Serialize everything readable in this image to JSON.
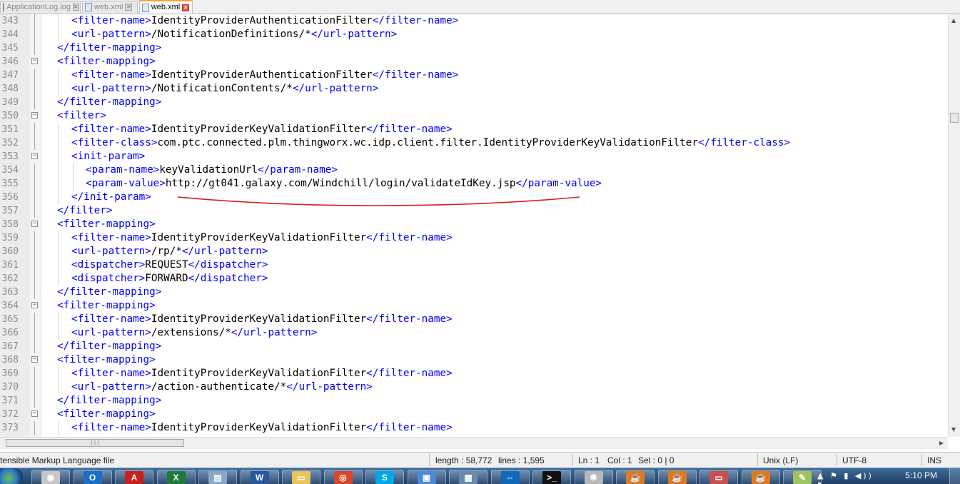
{
  "tabs": [
    {
      "label": "ApplicationLog.log",
      "active": false
    },
    {
      "label": "web.xml",
      "active": false
    },
    {
      "label": "web.xml",
      "active": true
    }
  ],
  "lines": [
    {
      "num": "343",
      "indent": 2,
      "segs": [
        {
          "s": "<filter-name>"
        },
        {
          "t": "IdentityProviderAuthenticationFilter"
        },
        {
          "s": "</filter-name>"
        }
      ]
    },
    {
      "num": "344",
      "indent": 2,
      "segs": [
        {
          "s": "<url-pattern>"
        },
        {
          "t": "/NotificationDefinitions/*"
        },
        {
          "s": "</url-pattern>"
        }
      ]
    },
    {
      "num": "345",
      "indent": 1,
      "segs": [
        {
          "s": "</filter-mapping>"
        }
      ]
    },
    {
      "num": "346",
      "indent": 1,
      "fold": true,
      "segs": [
        {
          "s": "<filter-mapping>"
        }
      ]
    },
    {
      "num": "347",
      "indent": 2,
      "segs": [
        {
          "s": "<filter-name>"
        },
        {
          "t": "IdentityProviderAuthenticationFilter"
        },
        {
          "s": "</filter-name>"
        }
      ]
    },
    {
      "num": "348",
      "indent": 2,
      "segs": [
        {
          "s": "<url-pattern>"
        },
        {
          "t": "/NotificationContents/*"
        },
        {
          "s": "</url-pattern>"
        }
      ]
    },
    {
      "num": "349",
      "indent": 1,
      "segs": [
        {
          "s": "</filter-mapping>"
        }
      ]
    },
    {
      "num": "350",
      "indent": 1,
      "fold": true,
      "segs": [
        {
          "s": "<filter>"
        }
      ]
    },
    {
      "num": "351",
      "indent": 2,
      "segs": [
        {
          "s": "<filter-name>"
        },
        {
          "t": "IdentityProviderKeyValidationFilter"
        },
        {
          "s": "</filter-name>"
        }
      ]
    },
    {
      "num": "352",
      "indent": 2,
      "segs": [
        {
          "s": "<filter-class>"
        },
        {
          "t": "com.ptc.connected.plm.thingworx.wc.idp.client.filter.IdentityProviderKeyValidationFilter"
        },
        {
          "s": "</filter-class>"
        }
      ]
    },
    {
      "num": "353",
      "indent": 2,
      "fold": true,
      "segs": [
        {
          "s": "<init-param>"
        }
      ]
    },
    {
      "num": "354",
      "indent": 3,
      "segs": [
        {
          "s": "<param-name>"
        },
        {
          "t": "keyValidationUrl"
        },
        {
          "s": "</param-name>"
        }
      ]
    },
    {
      "num": "355",
      "indent": 3,
      "segs": [
        {
          "s": "<param-value>"
        },
        {
          "t": "http://gt041.galaxy.com/Windchill/login/validateIdKey.jsp"
        },
        {
          "s": "</param-value>"
        }
      ]
    },
    {
      "num": "356",
      "indent": 2,
      "segs": [
        {
          "s": "</init-param>"
        }
      ]
    },
    {
      "num": "357",
      "indent": 1,
      "segs": [
        {
          "s": "</filter>"
        }
      ]
    },
    {
      "num": "358",
      "indent": 1,
      "fold": true,
      "segs": [
        {
          "s": "<filter-mapping>"
        }
      ]
    },
    {
      "num": "359",
      "indent": 2,
      "segs": [
        {
          "s": "<filter-name>"
        },
        {
          "t": "IdentityProviderKeyValidationFilter"
        },
        {
          "s": "</filter-name>"
        }
      ]
    },
    {
      "num": "360",
      "indent": 2,
      "segs": [
        {
          "s": "<url-pattern>"
        },
        {
          "t": "/rp/*"
        },
        {
          "s": "</url-pattern>"
        }
      ]
    },
    {
      "num": "361",
      "indent": 2,
      "segs": [
        {
          "s": "<dispatcher>"
        },
        {
          "t": "REQUEST"
        },
        {
          "s": "</dispatcher>"
        }
      ]
    },
    {
      "num": "362",
      "indent": 2,
      "segs": [
        {
          "s": "<dispatcher>"
        },
        {
          "t": "FORWARD"
        },
        {
          "s": "</dispatcher>"
        }
      ]
    },
    {
      "num": "363",
      "indent": 1,
      "segs": [
        {
          "s": "</filter-mapping>"
        }
      ]
    },
    {
      "num": "364",
      "indent": 1,
      "fold": true,
      "segs": [
        {
          "s": "<filter-mapping>"
        }
      ]
    },
    {
      "num": "365",
      "indent": 2,
      "segs": [
        {
          "s": "<filter-name>"
        },
        {
          "t": "IdentityProviderKeyValidationFilter"
        },
        {
          "s": "</filter-name>"
        }
      ]
    },
    {
      "num": "366",
      "indent": 2,
      "segs": [
        {
          "s": "<url-pattern>"
        },
        {
          "t": "/extensions/*"
        },
        {
          "s": "</url-pattern>"
        }
      ]
    },
    {
      "num": "367",
      "indent": 1,
      "segs": [
        {
          "s": "</filter-mapping>"
        }
      ]
    },
    {
      "num": "368",
      "indent": 1,
      "fold": true,
      "segs": [
        {
          "s": "<filter-mapping>"
        }
      ]
    },
    {
      "num": "369",
      "indent": 2,
      "segs": [
        {
          "s": "<filter-name>"
        },
        {
          "t": "IdentityProviderKeyValidationFilter"
        },
        {
          "s": "</filter-name>"
        }
      ]
    },
    {
      "num": "370",
      "indent": 2,
      "segs": [
        {
          "s": "<url-pattern>"
        },
        {
          "t": "/action-authenticate/*"
        },
        {
          "s": "</url-pattern>"
        }
      ]
    },
    {
      "num": "371",
      "indent": 1,
      "segs": [
        {
          "s": "</filter-mapping>"
        }
      ]
    },
    {
      "num": "372",
      "indent": 1,
      "fold": true,
      "segs": [
        {
          "s": "<filter-mapping>"
        }
      ]
    },
    {
      "num": "373",
      "indent": 2,
      "segs": [
        {
          "s": "<filter-name>"
        },
        {
          "t": "IdentityProviderKeyValidationFilter"
        },
        {
          "s": "</filter-name>"
        }
      ]
    }
  ],
  "annotation_color": "#d42020",
  "colors": {
    "tag": "#0000ff",
    "text": "#000000",
    "line_number": "#8c8c8c"
  },
  "status": {
    "file_type": "tensible Markup Language file",
    "length": "length : 58,772",
    "lines": "lines : 1,595",
    "ln": "Ln : 1",
    "col": "Col : 1",
    "sel": "Sel : 0 | 0",
    "eol": "Unix (LF)",
    "encoding": "UTF-8",
    "mode": "INS"
  },
  "taskbar": {
    "apps": [
      {
        "name": "media-player-icon",
        "glyph": "◉",
        "color": "#c8c8c8"
      },
      {
        "name": "outlook-icon",
        "glyph": "O",
        "color": "#1c6fc4"
      },
      {
        "name": "acrobat-icon",
        "glyph": "A",
        "color": "#c8201c"
      },
      {
        "name": "excel-icon",
        "glyph": "X",
        "color": "#1f7a3c"
      },
      {
        "name": "notes-icon",
        "glyph": "▤",
        "color": "#8aa6c8"
      },
      {
        "name": "word-icon",
        "glyph": "W",
        "color": "#2b579a"
      },
      {
        "name": "explorer-icon",
        "glyph": "▭",
        "color": "#e8c45a"
      },
      {
        "name": "chrome-icon",
        "glyph": "◎",
        "color": "#d9462f"
      },
      {
        "name": "skype-icon",
        "glyph": "S",
        "color": "#00a8e6"
      },
      {
        "name": "network-icon",
        "glyph": "▣",
        "color": "#4a8ad4"
      },
      {
        "name": "remote-desktop-icon",
        "glyph": "▦",
        "color": "#6a8ab0"
      },
      {
        "name": "teamviewer-icon",
        "glyph": "⇔",
        "color": "#0e6ab8"
      },
      {
        "name": "cmd-icon",
        "glyph": ">_",
        "color": "#111111"
      },
      {
        "name": "settings-icon",
        "glyph": "✱",
        "color": "#b8b8b8"
      },
      {
        "name": "java-icon-1",
        "glyph": "☕",
        "color": "#e07a1f"
      },
      {
        "name": "java-icon-2",
        "glyph": "☕",
        "color": "#e07a1f"
      },
      {
        "name": "window-icon",
        "glyph": "▭",
        "color": "#c85050"
      },
      {
        "name": "java-icon-3",
        "glyph": "☕",
        "color": "#e07a1f"
      },
      {
        "name": "notepadpp-icon",
        "glyph": "✎",
        "color": "#9ec460"
      }
    ],
    "clock": "5:10 PM"
  }
}
